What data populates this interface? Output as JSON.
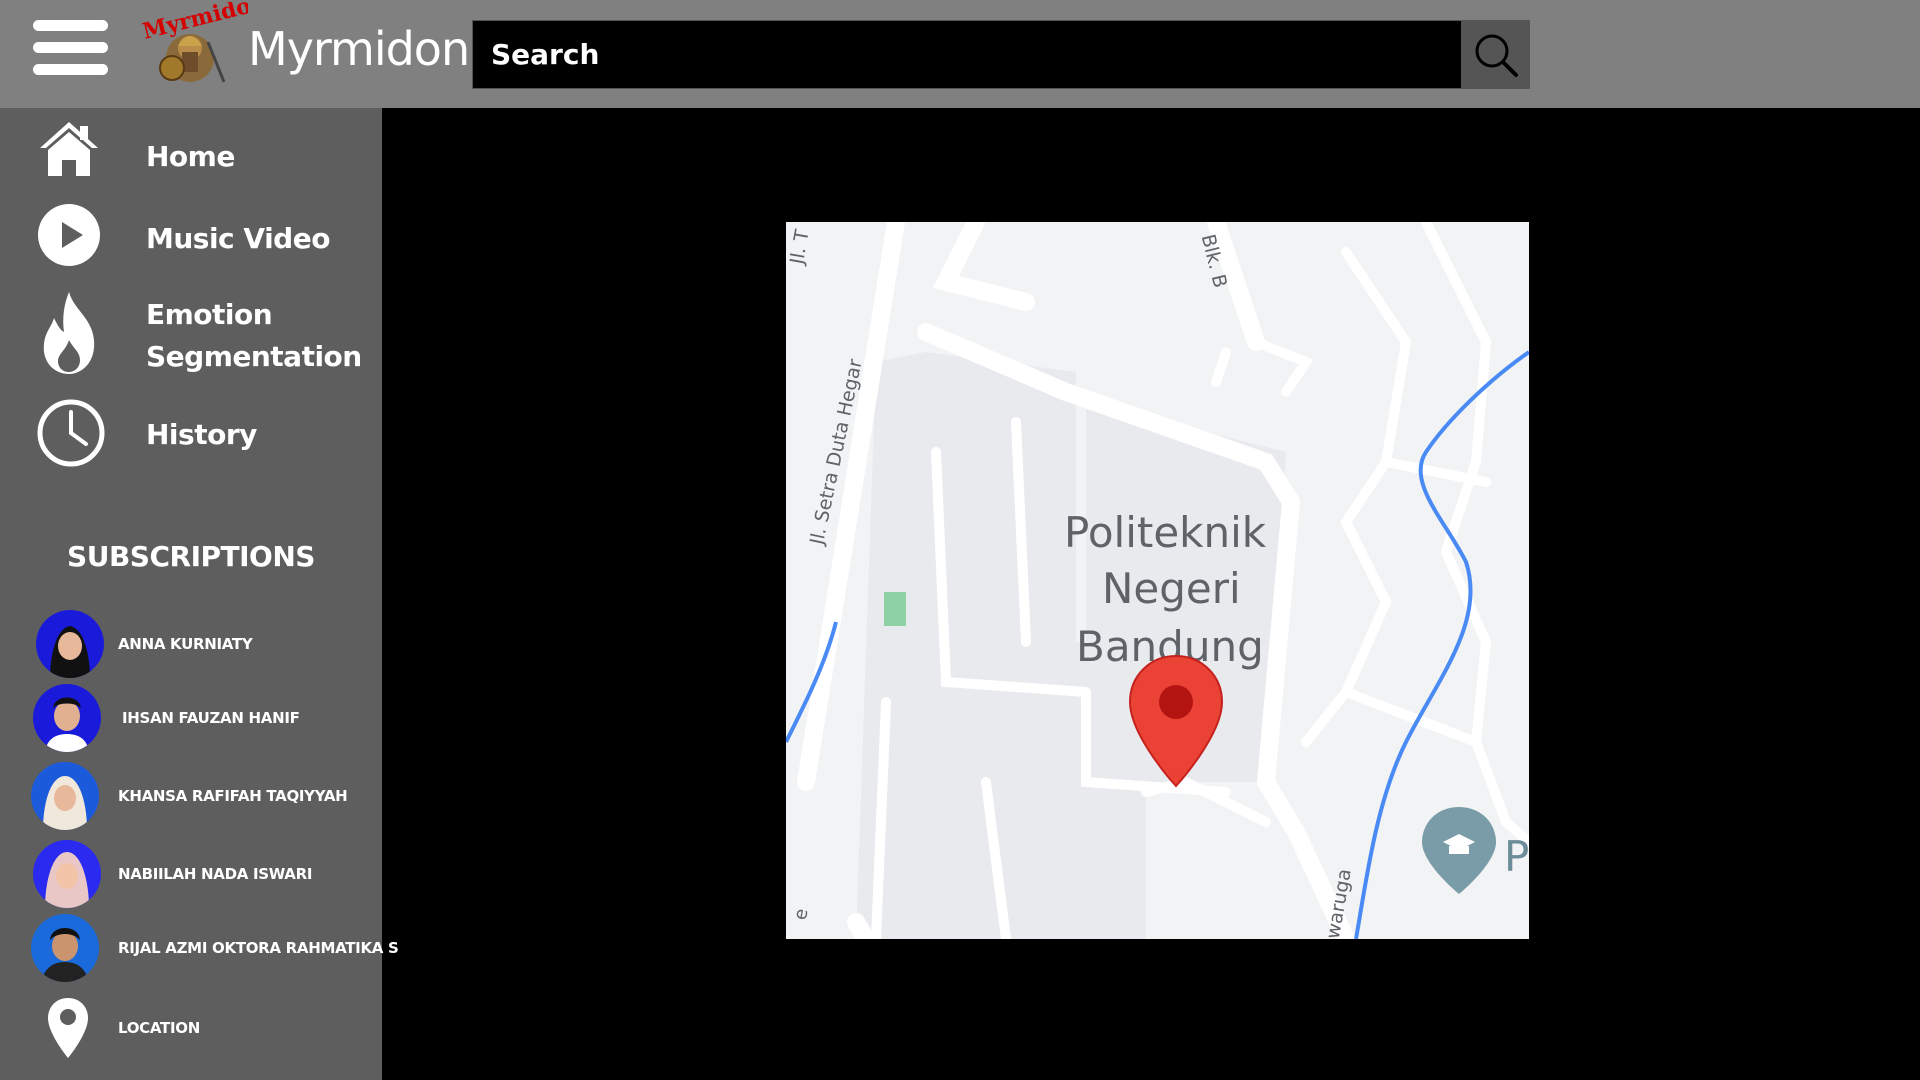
{
  "app": {
    "title": "Myrmidon",
    "logo_text": "Myrmidon"
  },
  "search": {
    "placeholder": "Search"
  },
  "nav": {
    "home": "Home",
    "music_video": "Music Video",
    "emotion_line1": "Emotion",
    "emotion_line2": "Segmentation",
    "history": "History"
  },
  "subscriptions": {
    "title": "SUBSCRIPTIONS",
    "items": [
      {
        "name": "ANNA KURNIATY"
      },
      {
        "name": "IHSAN FAUZAN HANIF"
      },
      {
        "name": "KHANSA RAFIFAH TAQIYYAH"
      },
      {
        "name": "NABIILAH NADA ISWARI"
      },
      {
        "name": "RIJAL AZMI OKTORA RAHMATIKA S"
      }
    ],
    "location": "LOCATION"
  },
  "map": {
    "place_line1": "Politeknik",
    "place_line2": "Negeri",
    "place_line3": "Bandung",
    "street1": "Jl. Setra Duta Hegar",
    "street2": "Blk. B",
    "street3": "Jl. T",
    "street4": "iwaruga",
    "poi_letter": "P",
    "edge_letter": "e",
    "pin_color": "#ea4335",
    "water_color": "#4a8af4"
  },
  "colors": {
    "header": "#808080",
    "sidebar": "#5e5e5e",
    "background": "#000000"
  }
}
